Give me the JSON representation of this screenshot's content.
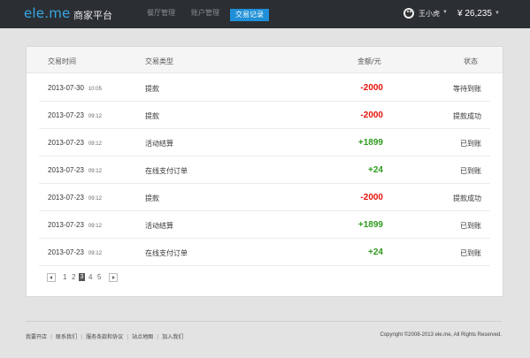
{
  "header": {
    "logo": "ele.me",
    "platform": "商家平台",
    "nav": [
      "餐厅管理",
      "账户管理",
      "交易记录"
    ],
    "active_nav": "交易记录",
    "user_name": "王小虎",
    "balance": "¥ 26,235"
  },
  "table": {
    "columns": [
      "交易时间",
      "交易类型",
      "金额/元",
      "状态"
    ],
    "rows": [
      {
        "date": "2013-07-30",
        "time": "10:05",
        "type": "提款",
        "amount": "-2000",
        "status": "等待到账"
      },
      {
        "date": "2013-07-23",
        "time": "09:12",
        "type": "提款",
        "amount": "-2000",
        "status": "提款成功"
      },
      {
        "date": "2013-07-23",
        "time": "09:12",
        "type": "活动结算",
        "amount": "+1899",
        "status": "已到账"
      },
      {
        "date": "2013-07-23",
        "time": "09:12",
        "type": "在线支付订单",
        "amount": "+24",
        "status": "已到账"
      },
      {
        "date": "2013-07-23",
        "time": "09:12",
        "type": "提款",
        "amount": "-2000",
        "status": "提款成功"
      },
      {
        "date": "2013-07-23",
        "time": "09:12",
        "type": "活动结算",
        "amount": "+1899",
        "status": "已到账"
      },
      {
        "date": "2013-07-23",
        "time": "09:12",
        "type": "在线支付订单",
        "amount": "+24",
        "status": "已到账"
      }
    ]
  },
  "pagination": {
    "pages": [
      "1",
      "2",
      "3",
      "4",
      "5"
    ],
    "current": "3"
  },
  "footer": {
    "links": [
      "我要开店",
      "联系我们",
      "服务条款和协议",
      "站点地图",
      "加入我们"
    ],
    "separator": "|",
    "copyright": "Copyright ©2008-2013 ele.me, All Rights Reserved."
  },
  "colors": {
    "negative": "#e8140c",
    "positive": "#2e9a1e",
    "accent": "#1f8fd8",
    "logo": "#37a8e6",
    "topbar": "#2b2f33"
  },
  "icons": [
    "avatar-tiger-icon",
    "chevron-down-icon",
    "page-prev-icon",
    "page-next-icon"
  ]
}
